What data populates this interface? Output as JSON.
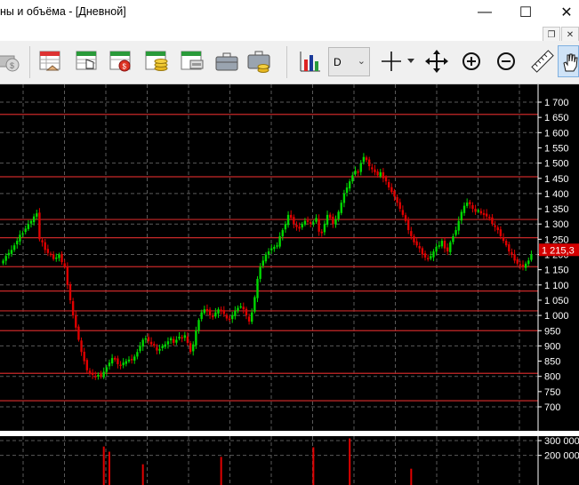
{
  "window": {
    "title": "ны и объёма - [Дневной]",
    "minimize_glyph": "—",
    "maximize_glyph": "☐",
    "close_glyph": "✕",
    "mdi_restore_glyph": "❐",
    "mdi_close_glyph": "✕"
  },
  "toolbar": {
    "icons": [
      "money-icon",
      "table-handshake-icon",
      "table-hand-icon",
      "table-coin-icon",
      "table-coins-icon",
      "table-stack-icon",
      "briefcase-icon",
      "briefcase-coins-icon",
      "chart-bars-icon",
      "crosshair-icon",
      "move-icon",
      "zoom-in-icon",
      "zoom-out-icon",
      "ruler-icon",
      "hand-icon"
    ],
    "timeframe": "D"
  },
  "chart_data": [
    {
      "type": "candlestick",
      "ylim": [
        700,
        1700
      ],
      "ytick_labels": [
        "1 700",
        "1 650",
        "1 600",
        "1 550",
        "1 500",
        "1 450",
        "1 400",
        "1 350",
        "1 300",
        "1 250",
        "1 200",
        "1 150",
        "1 100",
        "1 050",
        "1 000",
        "950",
        "900",
        "850",
        "800",
        "750",
        "700"
      ],
      "current_price_label": "1 215,3",
      "current_price": 1215.3,
      "horizontal_levels": [
        1660,
        1455,
        1315,
        1255,
        1160,
        1080,
        1015,
        950,
        810,
        720
      ],
      "close": [
        1180,
        1195,
        1205,
        1215,
        1230,
        1245,
        1265,
        1270,
        1285,
        1300,
        1310,
        1325,
        1335,
        1250,
        1240,
        1215,
        1205,
        1200,
        1185,
        1190,
        1200,
        1175,
        1160,
        1100,
        1050,
        1000,
        960,
        920,
        880,
        850,
        820,
        810,
        805,
        800,
        805,
        800,
        815,
        830,
        845,
        860,
        855,
        840,
        835,
        845,
        850,
        855,
        855,
        865,
        880,
        900,
        920,
        925,
        915,
        905,
        900,
        885,
        890,
        900,
        905,
        915,
        925,
        910,
        920,
        930,
        925,
        935,
        910,
        880,
        905,
        950,
        985,
        1010,
        1020,
        1015,
        1000,
        995,
        1010,
        1020,
        1015,
        1005,
        990,
        985,
        1000,
        1015,
        1025,
        1030,
        1020,
        1000,
        980,
        1010,
        1060,
        1120,
        1160,
        1180,
        1200,
        1210,
        1220,
        1225,
        1230,
        1260,
        1280,
        1300,
        1330,
        1320,
        1300,
        1290,
        1285,
        1300,
        1310,
        1310,
        1300,
        1305,
        1320,
        1275,
        1270,
        1300,
        1330,
        1320,
        1300,
        1315,
        1340,
        1370,
        1400,
        1420,
        1440,
        1460,
        1475,
        1470,
        1500,
        1520,
        1510,
        1490,
        1480,
        1470,
        1460,
        1470,
        1450,
        1440,
        1420,
        1405,
        1390,
        1370,
        1350,
        1330,
        1310,
        1280,
        1260,
        1240,
        1230,
        1220,
        1200,
        1190,
        1185,
        1195,
        1210,
        1225,
        1230,
        1245,
        1220,
        1210,
        1240,
        1260,
        1280,
        1310,
        1340,
        1360,
        1370,
        1365,
        1350,
        1340,
        1345,
        1335,
        1330,
        1325,
        1320,
        1300,
        1290,
        1280,
        1260,
        1245,
        1230,
        1210,
        1200,
        1180,
        1170,
        1165,
        1160,
        1170,
        1180,
        1200
      ]
    },
    {
      "type": "bar",
      "ylim": [
        0,
        330000
      ],
      "ytick_labels": [
        "300 000",
        "200 000"
      ],
      "spikes": [
        {
          "bar": 36,
          "value": 260000
        },
        {
          "bar": 38,
          "value": 225000
        },
        {
          "bar": 50,
          "value": 140000
        },
        {
          "bar": 78,
          "value": 190000
        },
        {
          "bar": 111,
          "value": 255000
        },
        {
          "bar": 124,
          "value": 315000
        },
        {
          "bar": 146,
          "value": 110000
        }
      ],
      "base_value": 80000
    }
  ],
  "colors": {
    "up": "#00d800",
    "down": "#e00000",
    "grid": "#5a5a5a",
    "level": "#c82828",
    "axis_text": "#ffffff",
    "price_marker": "#d40000"
  }
}
